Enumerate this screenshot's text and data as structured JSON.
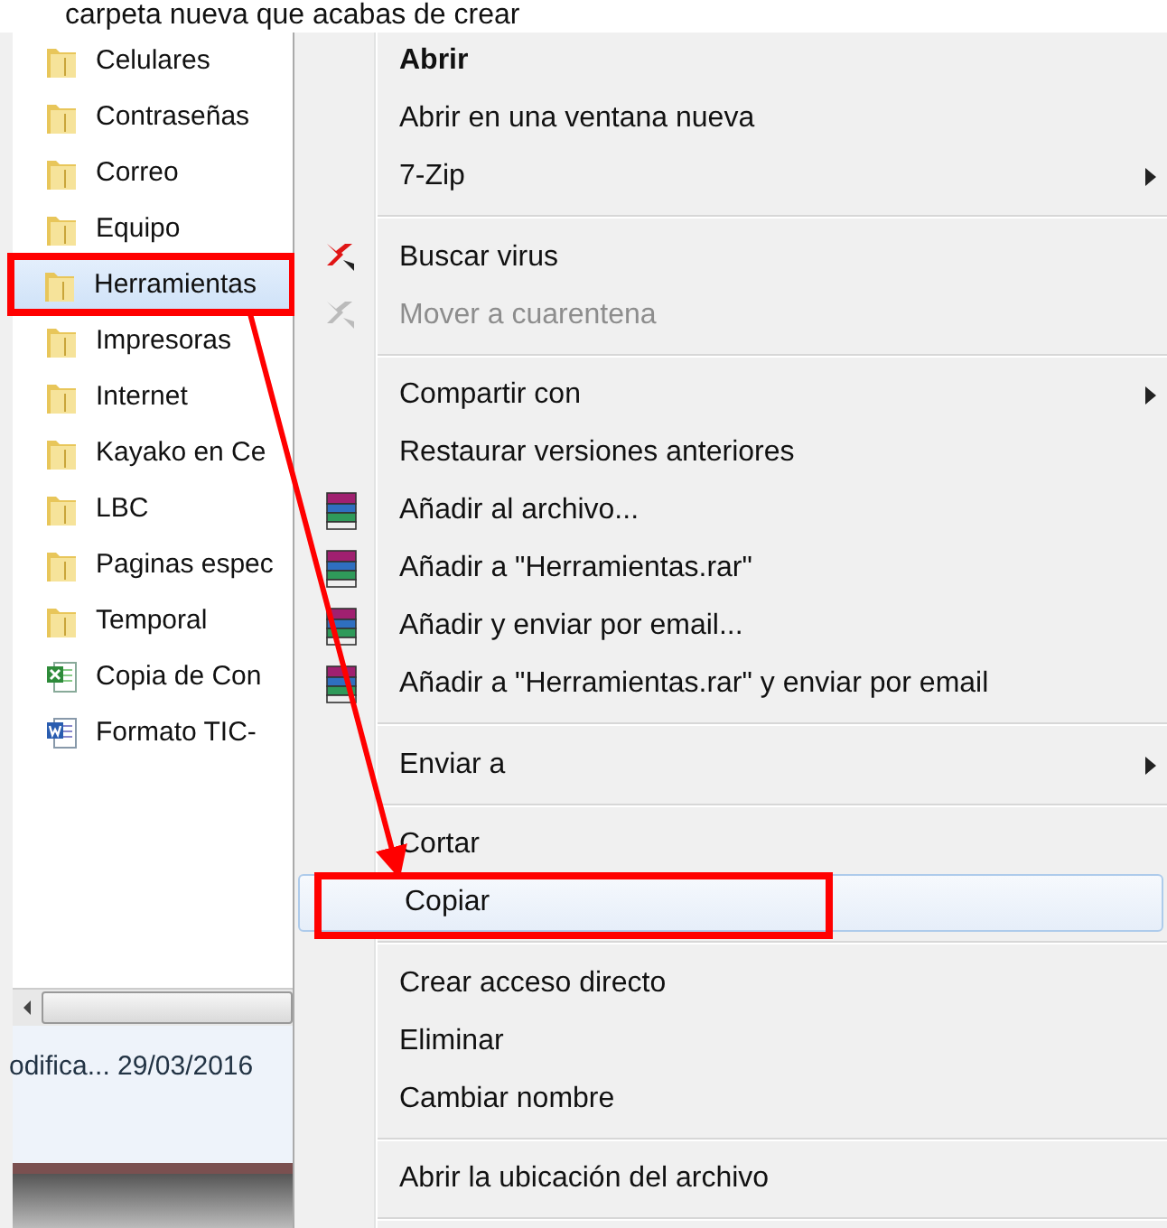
{
  "heading": "carpeta nueva que acabas de crear",
  "files": [
    {
      "name": "Celulares",
      "kind": "folder",
      "selected": false,
      "annotated": false
    },
    {
      "name": "Contraseñas",
      "kind": "folder",
      "selected": false,
      "annotated": false
    },
    {
      "name": "Correo",
      "kind": "folder",
      "selected": false,
      "annotated": false
    },
    {
      "name": "Equipo",
      "kind": "folder",
      "selected": false,
      "annotated": false
    },
    {
      "name": "Herramientas",
      "kind": "folder",
      "selected": true,
      "annotated": true
    },
    {
      "name": "Impresoras",
      "kind": "folder",
      "selected": false,
      "annotated": false
    },
    {
      "name": "Internet",
      "kind": "folder",
      "selected": false,
      "annotated": false
    },
    {
      "name": "Kayako en Ce",
      "kind": "folder",
      "selected": false,
      "annotated": false
    },
    {
      "name": "LBC",
      "kind": "folder",
      "selected": false,
      "annotated": false
    },
    {
      "name": "Paginas espec",
      "kind": "folder",
      "selected": false,
      "annotated": false
    },
    {
      "name": "Temporal",
      "kind": "folder",
      "selected": false,
      "annotated": false
    },
    {
      "name": "Copia de Con",
      "kind": "spreadsheet",
      "selected": false,
      "annotated": false
    },
    {
      "name": "Formato TIC-",
      "kind": "document",
      "selected": false,
      "annotated": false
    }
  ],
  "status": {
    "text": "odifica... 29/03/2016"
  },
  "menu": [
    {
      "kind": "plain",
      "label": "Abrir",
      "default": true,
      "disabled": false,
      "submenu": false,
      "selected": false,
      "annotated": false
    },
    {
      "kind": "plain",
      "label": "Abrir en una ventana nueva",
      "default": false,
      "disabled": false,
      "submenu": false,
      "selected": false,
      "annotated": false
    },
    {
      "kind": "plain",
      "label": "7-Zip",
      "default": false,
      "disabled": false,
      "submenu": true,
      "selected": false,
      "annotated": false
    },
    {
      "kind": "separator"
    },
    {
      "kind": "scan",
      "label": "Buscar virus",
      "default": false,
      "disabled": false,
      "submenu": false,
      "selected": false,
      "annotated": false
    },
    {
      "kind": "scan",
      "label": "Mover a cuarentena",
      "default": false,
      "disabled": true,
      "submenu": false,
      "selected": false,
      "annotated": false
    },
    {
      "kind": "separator"
    },
    {
      "kind": "plain",
      "label": "Compartir con",
      "default": false,
      "disabled": false,
      "submenu": true,
      "selected": false,
      "annotated": false
    },
    {
      "kind": "plain",
      "label": "Restaurar versiones anteriores",
      "default": false,
      "disabled": false,
      "submenu": false,
      "selected": false,
      "annotated": false
    },
    {
      "kind": "archive",
      "label": "Añadir al archivo...",
      "default": false,
      "disabled": false,
      "submenu": false,
      "selected": false,
      "annotated": false
    },
    {
      "kind": "archive",
      "label": "Añadir a \"Herramientas.rar\"",
      "default": false,
      "disabled": false,
      "submenu": false,
      "selected": false,
      "annotated": false
    },
    {
      "kind": "archive",
      "label": "Añadir y enviar por email...",
      "default": false,
      "disabled": false,
      "submenu": false,
      "selected": false,
      "annotated": false
    },
    {
      "kind": "archive",
      "label": "Añadir a \"Herramientas.rar\" y enviar por email",
      "default": false,
      "disabled": false,
      "submenu": false,
      "selected": false,
      "annotated": false
    },
    {
      "kind": "separator"
    },
    {
      "kind": "plain",
      "label": "Enviar a",
      "default": false,
      "disabled": false,
      "submenu": true,
      "selected": false,
      "annotated": false
    },
    {
      "kind": "separator"
    },
    {
      "kind": "plain",
      "label": "Cortar",
      "default": false,
      "disabled": false,
      "submenu": false,
      "selected": false,
      "annotated": false
    },
    {
      "kind": "plain",
      "label": "Copiar",
      "default": false,
      "disabled": false,
      "submenu": false,
      "selected": true,
      "annotated": true
    },
    {
      "kind": "separator"
    },
    {
      "kind": "plain",
      "label": "Crear acceso directo",
      "default": false,
      "disabled": false,
      "submenu": false,
      "selected": false,
      "annotated": false
    },
    {
      "kind": "plain",
      "label": "Eliminar",
      "default": false,
      "disabled": false,
      "submenu": false,
      "selected": false,
      "annotated": false
    },
    {
      "kind": "plain",
      "label": "Cambiar nombre",
      "default": false,
      "disabled": false,
      "submenu": false,
      "selected": false,
      "annotated": false
    },
    {
      "kind": "separator"
    },
    {
      "kind": "plain",
      "label": "Abrir la ubicación del archivo",
      "default": false,
      "disabled": false,
      "submenu": false,
      "selected": false,
      "annotated": false
    },
    {
      "kind": "separator"
    }
  ]
}
